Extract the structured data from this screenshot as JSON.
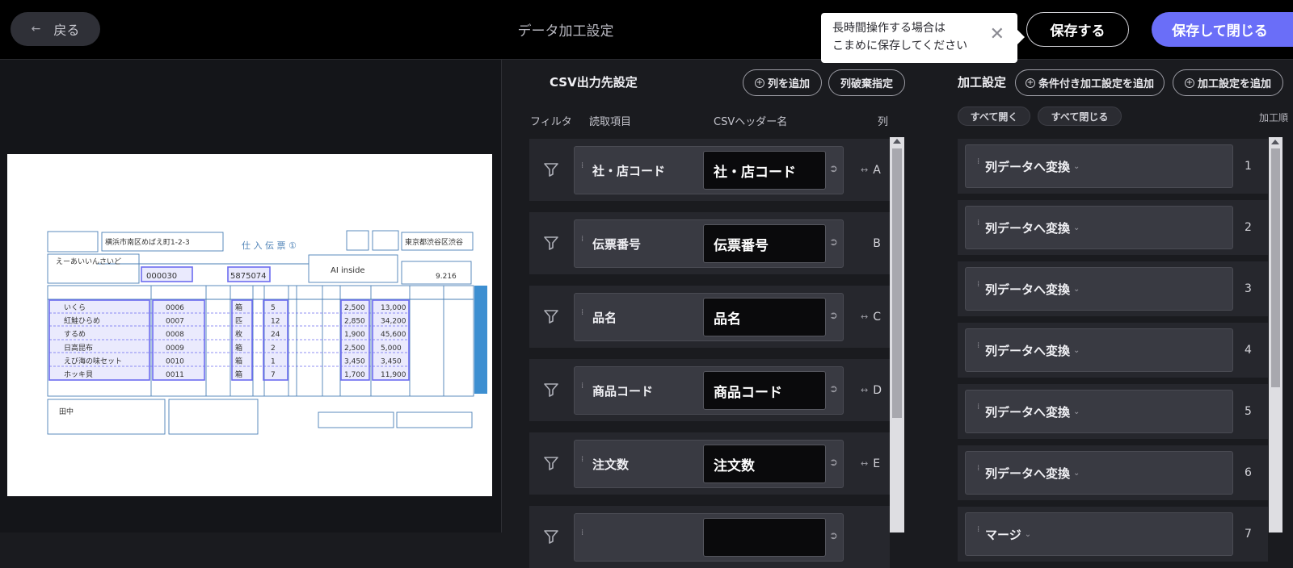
{
  "header": {
    "back_label": "戻る",
    "title": "データ加工設定",
    "toast_line1": "長時間操作する場合は",
    "toast_line2": "こまめに保存してください",
    "toast_close": "✕",
    "save_label": "保存する",
    "save_close_label": "保存して閉じる"
  },
  "preview": {
    "document": {
      "address": "横浜市南区めばえ町1-2-3",
      "form_title": "仕 入 伝 票 ①",
      "store_code": "000030",
      "slip_number": "5875074",
      "vendor": "AI inside",
      "destination": "東京都渋谷区渋谷",
      "date": "9.216",
      "customer": "えーあいいんさいど",
      "signature": "田中",
      "items": [
        {
          "name": "いくら",
          "code": "0006",
          "unit": "箱",
          "qty": "5",
          "price": "2,500",
          "amount": "13,000"
        },
        {
          "name": "紅鮭ひらめ",
          "code": "0007",
          "unit": "匹",
          "qty": "12",
          "price": "2,850",
          "amount": "34,200"
        },
        {
          "name": "するめ",
          "code": "0008",
          "unit": "枚",
          "qty": "24",
          "price": "1,900",
          "amount": "45,600"
        },
        {
          "name": "日高昆布",
          "code": "0009",
          "unit": "箱",
          "qty": "2",
          "price": "2,500",
          "amount": "5,000"
        },
        {
          "name": "えび海の味セット",
          "code": "0010",
          "unit": "箱",
          "qty": "1",
          "price": "3,450",
          "amount": "3,450"
        },
        {
          "name": "ホッキ貝",
          "code": "0011",
          "unit": "箱",
          "qty": "7",
          "price": "1,700",
          "amount": "11,900"
        }
      ]
    }
  },
  "csv": {
    "title": "CSV出力先設定",
    "add_column": "列を追加",
    "discard_column": "列破棄指定",
    "headers": {
      "filter": "フィルタ",
      "read_item": "読取項目",
      "csv_header": "CSVヘッダー名",
      "column": "列"
    },
    "rows": [
      {
        "read": "社・店コード",
        "header": "社・店コード",
        "col": "A",
        "move": true
      },
      {
        "read": "伝票番号",
        "header": "伝票番号",
        "col": "B",
        "move": false
      },
      {
        "read": "品名",
        "header": "品名",
        "col": "C",
        "move": true
      },
      {
        "read": "商品コード",
        "header": "商品コード",
        "col": "D",
        "move": true
      },
      {
        "read": "注文数",
        "header": "注文数",
        "col": "E",
        "move": true
      },
      {
        "read": "",
        "header": "",
        "col": "",
        "move": false
      }
    ]
  },
  "processing": {
    "title": "加工設定",
    "add_conditional": "条件付き加工設定を追加",
    "add_processing": "加工設定を追加",
    "expand_all": "すべて開く",
    "collapse_all": "すべて閉じる",
    "order_header": "加工順",
    "steps": [
      {
        "label": "列データへ変換",
        "order": "1"
      },
      {
        "label": "列データへ変換",
        "order": "2"
      },
      {
        "label": "列データへ変換",
        "order": "3"
      },
      {
        "label": "列データへ変換",
        "order": "4"
      },
      {
        "label": "列データへ変換",
        "order": "5"
      },
      {
        "label": "列データへ変換",
        "order": "6"
      },
      {
        "label": "マージ",
        "order": "7"
      }
    ]
  },
  "colors": {
    "accent": "#6a6ef8",
    "header_bg": "#000000",
    "panel_bg": "#1a1b1f",
    "row_bg": "#26272d",
    "card_bg": "#393a42",
    "input_bg": "#0a0a0c",
    "form_blue": "#4a7fb5",
    "highlight": "#6c6cf0"
  },
  "icons": {
    "back": "arrow-left-icon",
    "close": "close-icon",
    "filter": "filter-funnel-icon",
    "grip": "drag-handle-icon",
    "link": "link-arrow-icon",
    "move": "left-right-arrow-icon",
    "plus": "plus-circle-icon",
    "chevron": "chevron-down-icon"
  }
}
